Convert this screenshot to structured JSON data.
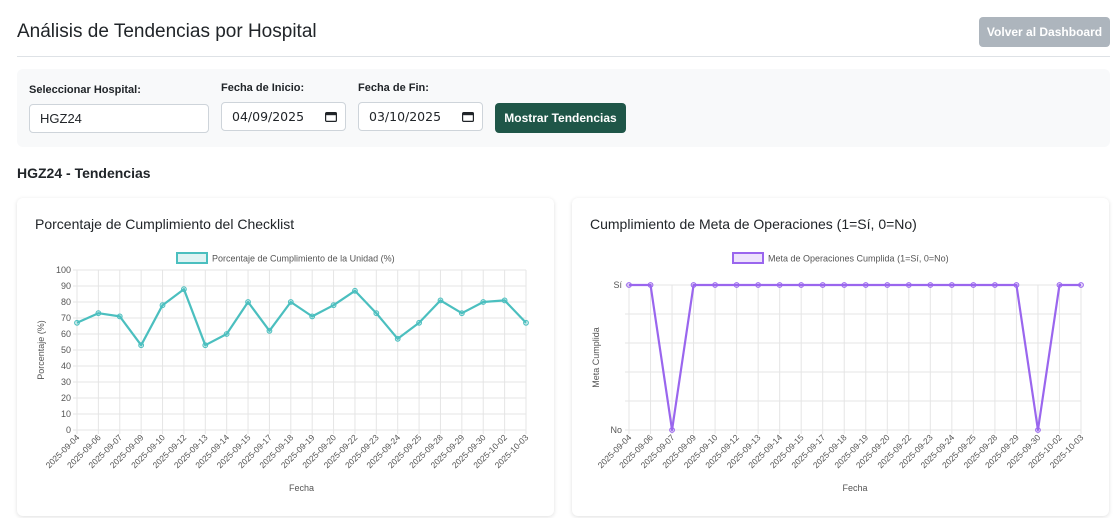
{
  "page": {
    "title": "Análisis de Tendencias por Hospital",
    "back_label": "Volver al Dashboard"
  },
  "filters": {
    "hospital_label": "Seleccionar Hospital:",
    "hospital_value": "HGZ24",
    "start_label": "Fecha de Inicio:",
    "start_value": "04/09/2025",
    "end_label": "Fecha de Fin:",
    "end_value": "03/10/2025",
    "submit_label": "Mostrar Tendencias"
  },
  "section": {
    "title": "HGZ24 - Tendencias"
  },
  "colors": {
    "checklist": "#4bbfbf",
    "operaciones": "#9a66ee",
    "primary_button": "#1f5648",
    "secondary_button": "#adb5bd"
  },
  "chart_data": [
    {
      "type": "line",
      "title": "Porcentaje de Cumplimiento del Checklist",
      "x": [
        "2025-09-04",
        "2025-09-06",
        "2025-09-07",
        "2025-09-09",
        "2025-09-10",
        "2025-09-12",
        "2025-09-13",
        "2025-09-14",
        "2025-09-15",
        "2025-09-17",
        "2025-09-18",
        "2025-09-19",
        "2025-09-20",
        "2025-09-22",
        "2025-09-23",
        "2025-09-24",
        "2025-09-25",
        "2025-09-28",
        "2025-09-29",
        "2025-09-30",
        "2025-10-02",
        "2025-10-03"
      ],
      "series": [
        {
          "name": "Porcentaje de Cumplimiento de la Unidad (%)",
          "values": [
            67,
            73,
            71,
            53,
            78,
            88,
            53,
            60,
            80,
            62,
            80,
            71,
            78,
            87,
            73,
            57,
            67,
            81,
            73,
            80,
            81,
            67
          ]
        }
      ],
      "xlabel": "Fecha",
      "ylabel": "Porcentaje (%)",
      "ylim": [
        0,
        100
      ],
      "yticks": [
        "0",
        "10",
        "20",
        "30",
        "40",
        "50",
        "60",
        "70",
        "80",
        "90",
        "100"
      ],
      "grid": true,
      "legend": "top"
    },
    {
      "type": "line",
      "title": "Cumplimiento de Meta de Operaciones (1=Sí, 0=No)",
      "x": [
        "2025-09-04",
        "2025-09-06",
        "2025-09-07",
        "2025-09-09",
        "2025-09-10",
        "2025-09-12",
        "2025-09-13",
        "2025-09-14",
        "2025-09-15",
        "2025-09-17",
        "2025-09-18",
        "2025-09-19",
        "2025-09-20",
        "2025-09-22",
        "2025-09-23",
        "2025-09-24",
        "2025-09-25",
        "2025-09-28",
        "2025-09-29",
        "2025-09-30",
        "2025-10-02",
        "2025-10-03"
      ],
      "series": [
        {
          "name": "Meta de Operaciones Cumplida (1=Sí, 0=No)",
          "values": [
            1,
            1,
            0,
            1,
            1,
            1,
            1,
            1,
            1,
            1,
            1,
            1,
            1,
            1,
            1,
            1,
            1,
            1,
            1,
            0,
            1,
            1
          ]
        }
      ],
      "xlabel": "Fecha",
      "ylabel": "Meta Cumplida",
      "ylim": [
        0,
        1
      ],
      "yticks": [
        "No",
        "Sí"
      ],
      "grid": true,
      "legend": "top"
    }
  ]
}
